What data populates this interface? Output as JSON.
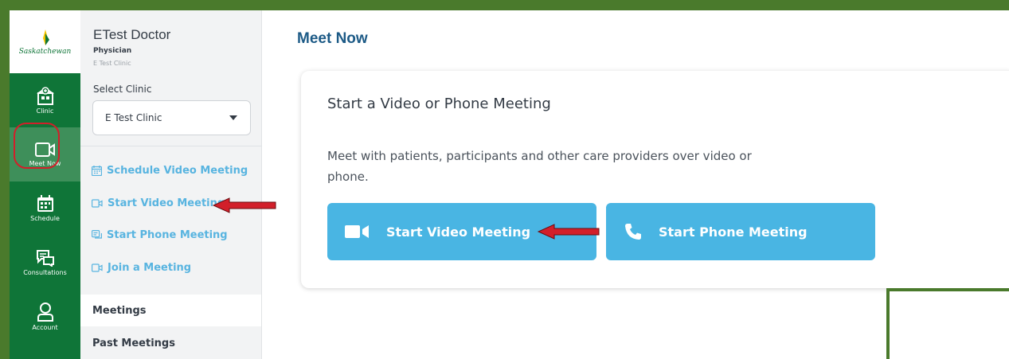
{
  "brand": {
    "wordmark": "Saskatchewan"
  },
  "rail": {
    "items": [
      {
        "label": "Clinic",
        "icon": "clinic-icon"
      },
      {
        "label": "Meet Now",
        "icon": "video-camera-icon"
      },
      {
        "label": "Schedule",
        "icon": "calendar-icon"
      },
      {
        "label": "Consultations",
        "icon": "chat-icon"
      },
      {
        "label": "Account",
        "icon": "person-icon"
      }
    ]
  },
  "user": {
    "name": "ETest Doctor",
    "role": "Physician",
    "clinic": "E Test Clinic"
  },
  "clinic_select": {
    "label": "Select Clinic",
    "value": "E Test Clinic"
  },
  "subnav": {
    "links": [
      {
        "label": "Schedule Video Meeting",
        "icon": "calendar-icon"
      },
      {
        "label": "Start Video Meeting",
        "icon": "video-camera-icon"
      },
      {
        "label": "Start Phone Meeting",
        "icon": "phone-icon"
      },
      {
        "label": "Join a Meeting",
        "icon": "video-camera-icon"
      }
    ],
    "sections": [
      "Meetings",
      "Past Meetings"
    ]
  },
  "main": {
    "title": "Meet Now",
    "card_title": "Start a Video or Phone Meeting",
    "card_description": "Meet with patients, participants and other care providers over video or phone.",
    "buttons": [
      {
        "label": "Start Video Meeting",
        "icon": "video-camera-icon"
      },
      {
        "label": "Start Phone Meeting",
        "icon": "phone-icon"
      }
    ]
  },
  "colors": {
    "rail_green": "#0f7538",
    "accent_blue": "#49b5e3",
    "link_blue": "#58b4e0",
    "title_blue": "#1c5a86",
    "annotation_red": "#d21f2a",
    "frame_green": "#4a7a2c"
  }
}
